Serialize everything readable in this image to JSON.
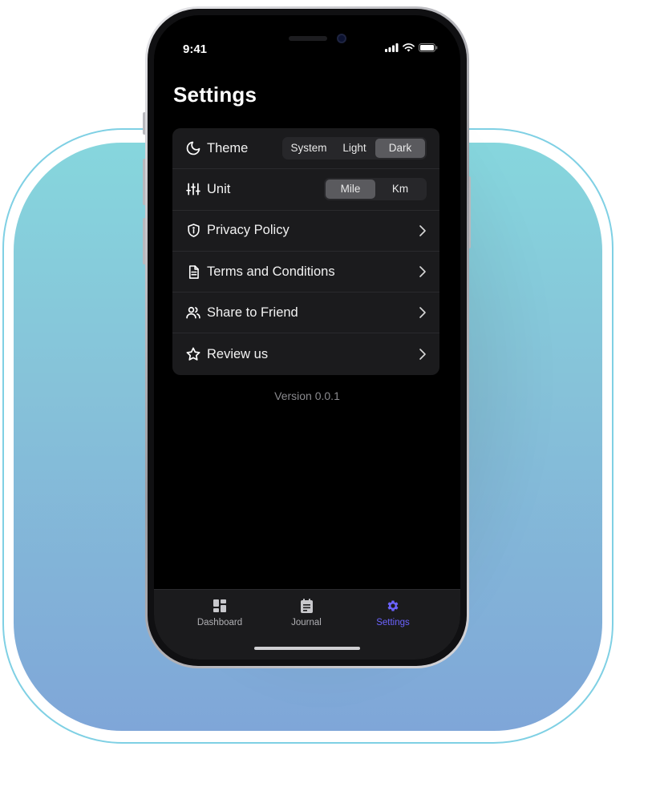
{
  "status": {
    "time": "9:41"
  },
  "header": {
    "title": "Settings"
  },
  "settings": {
    "theme": {
      "label": "Theme",
      "options": [
        "System",
        "Light",
        "Dark"
      ],
      "selected": "Dark"
    },
    "unit": {
      "label": "Unit",
      "options": [
        "Mile",
        "Km"
      ],
      "selected": "Mile"
    },
    "links": [
      {
        "label": "Privacy Policy",
        "icon": "shield-icon"
      },
      {
        "label": "Terms and Conditions",
        "icon": "document-icon"
      },
      {
        "label": "Share to Friend",
        "icon": "users-icon"
      },
      {
        "label": "Review us",
        "icon": "star-icon"
      }
    ]
  },
  "footer": {
    "version": "Version 0.0.1"
  },
  "tabbar": {
    "items": [
      {
        "label": "Dashboard",
        "icon": "dashboard-icon"
      },
      {
        "label": "Journal",
        "icon": "journal-icon"
      },
      {
        "label": "Settings",
        "icon": "gear-icon",
        "active": true
      }
    ]
  },
  "colors": {
    "accent": "#6c63ff",
    "card": "#1b1b1d",
    "screen": "#000000"
  }
}
